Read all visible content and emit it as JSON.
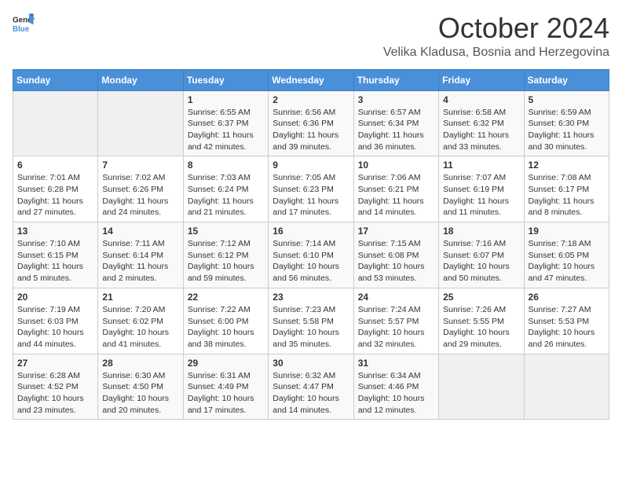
{
  "header": {
    "logo_general": "General",
    "logo_blue": "Blue",
    "title": "October 2024",
    "subtitle": "Velika Kladusa, Bosnia and Herzegovina"
  },
  "weekdays": [
    "Sunday",
    "Monday",
    "Tuesday",
    "Wednesday",
    "Thursday",
    "Friday",
    "Saturday"
  ],
  "weeks": [
    [
      {
        "day": "",
        "empty": true
      },
      {
        "day": "",
        "empty": true
      },
      {
        "day": "1",
        "sunrise": "Sunrise: 6:55 AM",
        "sunset": "Sunset: 6:37 PM",
        "daylight": "Daylight: 11 hours and 42 minutes."
      },
      {
        "day": "2",
        "sunrise": "Sunrise: 6:56 AM",
        "sunset": "Sunset: 6:36 PM",
        "daylight": "Daylight: 11 hours and 39 minutes."
      },
      {
        "day": "3",
        "sunrise": "Sunrise: 6:57 AM",
        "sunset": "Sunset: 6:34 PM",
        "daylight": "Daylight: 11 hours and 36 minutes."
      },
      {
        "day": "4",
        "sunrise": "Sunrise: 6:58 AM",
        "sunset": "Sunset: 6:32 PM",
        "daylight": "Daylight: 11 hours and 33 minutes."
      },
      {
        "day": "5",
        "sunrise": "Sunrise: 6:59 AM",
        "sunset": "Sunset: 6:30 PM",
        "daylight": "Daylight: 11 hours and 30 minutes."
      }
    ],
    [
      {
        "day": "6",
        "sunrise": "Sunrise: 7:01 AM",
        "sunset": "Sunset: 6:28 PM",
        "daylight": "Daylight: 11 hours and 27 minutes."
      },
      {
        "day": "7",
        "sunrise": "Sunrise: 7:02 AM",
        "sunset": "Sunset: 6:26 PM",
        "daylight": "Daylight: 11 hours and 24 minutes."
      },
      {
        "day": "8",
        "sunrise": "Sunrise: 7:03 AM",
        "sunset": "Sunset: 6:24 PM",
        "daylight": "Daylight: 11 hours and 21 minutes."
      },
      {
        "day": "9",
        "sunrise": "Sunrise: 7:05 AM",
        "sunset": "Sunset: 6:23 PM",
        "daylight": "Daylight: 11 hours and 17 minutes."
      },
      {
        "day": "10",
        "sunrise": "Sunrise: 7:06 AM",
        "sunset": "Sunset: 6:21 PM",
        "daylight": "Daylight: 11 hours and 14 minutes."
      },
      {
        "day": "11",
        "sunrise": "Sunrise: 7:07 AM",
        "sunset": "Sunset: 6:19 PM",
        "daylight": "Daylight: 11 hours and 11 minutes."
      },
      {
        "day": "12",
        "sunrise": "Sunrise: 7:08 AM",
        "sunset": "Sunset: 6:17 PM",
        "daylight": "Daylight: 11 hours and 8 minutes."
      }
    ],
    [
      {
        "day": "13",
        "sunrise": "Sunrise: 7:10 AM",
        "sunset": "Sunset: 6:15 PM",
        "daylight": "Daylight: 11 hours and 5 minutes."
      },
      {
        "day": "14",
        "sunrise": "Sunrise: 7:11 AM",
        "sunset": "Sunset: 6:14 PM",
        "daylight": "Daylight: 11 hours and 2 minutes."
      },
      {
        "day": "15",
        "sunrise": "Sunrise: 7:12 AM",
        "sunset": "Sunset: 6:12 PM",
        "daylight": "Daylight: 10 hours and 59 minutes."
      },
      {
        "day": "16",
        "sunrise": "Sunrise: 7:14 AM",
        "sunset": "Sunset: 6:10 PM",
        "daylight": "Daylight: 10 hours and 56 minutes."
      },
      {
        "day": "17",
        "sunrise": "Sunrise: 7:15 AM",
        "sunset": "Sunset: 6:08 PM",
        "daylight": "Daylight: 10 hours and 53 minutes."
      },
      {
        "day": "18",
        "sunrise": "Sunrise: 7:16 AM",
        "sunset": "Sunset: 6:07 PM",
        "daylight": "Daylight: 10 hours and 50 minutes."
      },
      {
        "day": "19",
        "sunrise": "Sunrise: 7:18 AM",
        "sunset": "Sunset: 6:05 PM",
        "daylight": "Daylight: 10 hours and 47 minutes."
      }
    ],
    [
      {
        "day": "20",
        "sunrise": "Sunrise: 7:19 AM",
        "sunset": "Sunset: 6:03 PM",
        "daylight": "Daylight: 10 hours and 44 minutes."
      },
      {
        "day": "21",
        "sunrise": "Sunrise: 7:20 AM",
        "sunset": "Sunset: 6:02 PM",
        "daylight": "Daylight: 10 hours and 41 minutes."
      },
      {
        "day": "22",
        "sunrise": "Sunrise: 7:22 AM",
        "sunset": "Sunset: 6:00 PM",
        "daylight": "Daylight: 10 hours and 38 minutes."
      },
      {
        "day": "23",
        "sunrise": "Sunrise: 7:23 AM",
        "sunset": "Sunset: 5:58 PM",
        "daylight": "Daylight: 10 hours and 35 minutes."
      },
      {
        "day": "24",
        "sunrise": "Sunrise: 7:24 AM",
        "sunset": "Sunset: 5:57 PM",
        "daylight": "Daylight: 10 hours and 32 minutes."
      },
      {
        "day": "25",
        "sunrise": "Sunrise: 7:26 AM",
        "sunset": "Sunset: 5:55 PM",
        "daylight": "Daylight: 10 hours and 29 minutes."
      },
      {
        "day": "26",
        "sunrise": "Sunrise: 7:27 AM",
        "sunset": "Sunset: 5:53 PM",
        "daylight": "Daylight: 10 hours and 26 minutes."
      }
    ],
    [
      {
        "day": "27",
        "sunrise": "Sunrise: 6:28 AM",
        "sunset": "Sunset: 4:52 PM",
        "daylight": "Daylight: 10 hours and 23 minutes."
      },
      {
        "day": "28",
        "sunrise": "Sunrise: 6:30 AM",
        "sunset": "Sunset: 4:50 PM",
        "daylight": "Daylight: 10 hours and 20 minutes."
      },
      {
        "day": "29",
        "sunrise": "Sunrise: 6:31 AM",
        "sunset": "Sunset: 4:49 PM",
        "daylight": "Daylight: 10 hours and 17 minutes."
      },
      {
        "day": "30",
        "sunrise": "Sunrise: 6:32 AM",
        "sunset": "Sunset: 4:47 PM",
        "daylight": "Daylight: 10 hours and 14 minutes."
      },
      {
        "day": "31",
        "sunrise": "Sunrise: 6:34 AM",
        "sunset": "Sunset: 4:46 PM",
        "daylight": "Daylight: 10 hours and 12 minutes."
      },
      {
        "day": "",
        "empty": true
      },
      {
        "day": "",
        "empty": true
      }
    ]
  ]
}
